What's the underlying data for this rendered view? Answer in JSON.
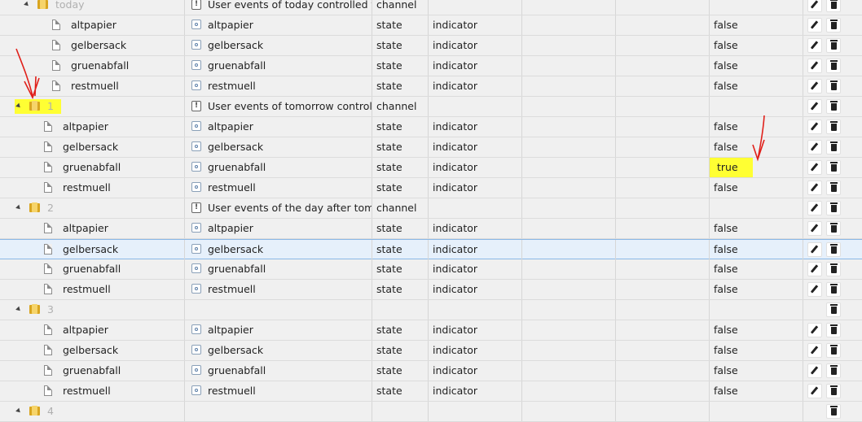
{
  "colors": {
    "highlight": "#ffff33",
    "annotation": "#e0201a",
    "selected_row": "#e6f0fb"
  },
  "rows": [
    {
      "type": "folder",
      "level": 1,
      "name": "today",
      "desc": "User events of today controlled f...",
      "role": "channel",
      "unit": "",
      "value": "",
      "showEdit": true
    },
    {
      "type": "state",
      "level": 2,
      "name": "altpapier",
      "desc": "altpapier",
      "role": "state",
      "unit": "indicator",
      "value": "false",
      "showEdit": true
    },
    {
      "type": "state",
      "level": 2,
      "name": "gelbersack",
      "desc": "gelbersack",
      "role": "state",
      "unit": "indicator",
      "value": "false",
      "showEdit": true
    },
    {
      "type": "state",
      "level": 2,
      "name": "gruenabfall",
      "desc": "gruenabfall",
      "role": "state",
      "unit": "indicator",
      "value": "false",
      "showEdit": true
    },
    {
      "type": "state",
      "level": 2,
      "name": "restmuell",
      "desc": "restmuell",
      "role": "state",
      "unit": "indicator",
      "value": "false",
      "showEdit": true
    },
    {
      "type": "folder",
      "level": 0,
      "name": "1",
      "desc": "User events of tomorrow control...",
      "role": "channel",
      "unit": "",
      "value": "",
      "showEdit": true,
      "highlight": true
    },
    {
      "type": "state",
      "level": 1,
      "name": "altpapier",
      "desc": "altpapier",
      "role": "state",
      "unit": "indicator",
      "value": "false",
      "showEdit": true
    },
    {
      "type": "state",
      "level": 1,
      "name": "gelbersack",
      "desc": "gelbersack",
      "role": "state",
      "unit": "indicator",
      "value": "false",
      "showEdit": true
    },
    {
      "type": "state",
      "level": 1,
      "name": "gruenabfall",
      "desc": "gruenabfall",
      "role": "state",
      "unit": "indicator",
      "value": "true",
      "showEdit": true,
      "valueHighlight": true
    },
    {
      "type": "state",
      "level": 1,
      "name": "restmuell",
      "desc": "restmuell",
      "role": "state",
      "unit": "indicator",
      "value": "false",
      "showEdit": true
    },
    {
      "type": "folder",
      "level": 0,
      "name": "2",
      "desc": "User events of the day after tom...",
      "role": "channel",
      "unit": "",
      "value": "",
      "showEdit": true
    },
    {
      "type": "state",
      "level": 1,
      "name": "altpapier",
      "desc": "altpapier",
      "role": "state",
      "unit": "indicator",
      "value": "false",
      "showEdit": true
    },
    {
      "type": "state",
      "level": 1,
      "name": "gelbersack",
      "desc": "gelbersack",
      "role": "state",
      "unit": "indicator",
      "value": "false",
      "showEdit": true,
      "selected": true
    },
    {
      "type": "state",
      "level": 1,
      "name": "gruenabfall",
      "desc": "gruenabfall",
      "role": "state",
      "unit": "indicator",
      "value": "false",
      "showEdit": true
    },
    {
      "type": "state",
      "level": 1,
      "name": "restmuell",
      "desc": "restmuell",
      "role": "state",
      "unit": "indicator",
      "value": "false",
      "showEdit": true
    },
    {
      "type": "folder",
      "level": 0,
      "name": "3",
      "desc": "",
      "role": "",
      "unit": "",
      "value": "",
      "showEdit": false
    },
    {
      "type": "state",
      "level": 1,
      "name": "altpapier",
      "desc": "altpapier",
      "role": "state",
      "unit": "indicator",
      "value": "false",
      "showEdit": true
    },
    {
      "type": "state",
      "level": 1,
      "name": "gelbersack",
      "desc": "gelbersack",
      "role": "state",
      "unit": "indicator",
      "value": "false",
      "showEdit": true
    },
    {
      "type": "state",
      "level": 1,
      "name": "gruenabfall",
      "desc": "gruenabfall",
      "role": "state",
      "unit": "indicator",
      "value": "false",
      "showEdit": true
    },
    {
      "type": "state",
      "level": 1,
      "name": "restmuell",
      "desc": "restmuell",
      "role": "state",
      "unit": "indicator",
      "value": "false",
      "showEdit": true
    },
    {
      "type": "folder",
      "level": 0,
      "name": "4",
      "desc": "",
      "role": "",
      "unit": "",
      "value": "",
      "showEdit": false
    }
  ]
}
